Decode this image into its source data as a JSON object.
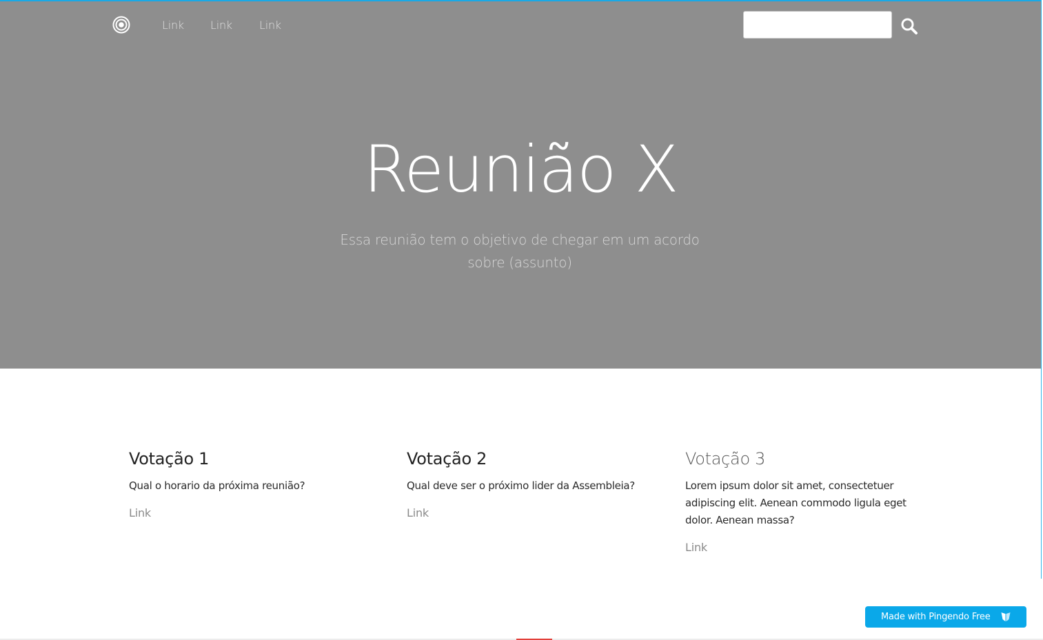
{
  "navbar": {
    "brand_icon": "target-icon",
    "links": [
      "Link",
      "Link",
      "Link"
    ],
    "search_icon": "search-icon",
    "search_value": "",
    "search_placeholder": ""
  },
  "hero": {
    "title": "Reunião X",
    "subtitle": "Essa reunião tem o objetivo de chegar em um acordo sobre (assunto)"
  },
  "columns": [
    {
      "title": "Votação 1",
      "text": "Qual o horario da próxima reunião?",
      "link": "Link"
    },
    {
      "title": "Votação 2",
      "text": "Qual deve ser o próximo lider da Assembleia?",
      "link": "Link"
    },
    {
      "title": "Votação 3",
      "text": "Lorem ipsum dolor sit amet, consectetuer adipiscing elit. Aenean commodo ligula eget dolor. Aenean massa?",
      "link": "Link"
    }
  ],
  "badge": {
    "label": "Made with Pingendo Free",
    "icon": "pingendo-heart-icon"
  },
  "colors": {
    "accent": "#0aa8e9",
    "hero_bg": "#8e8e8e",
    "top_line": "#19a9e6"
  }
}
